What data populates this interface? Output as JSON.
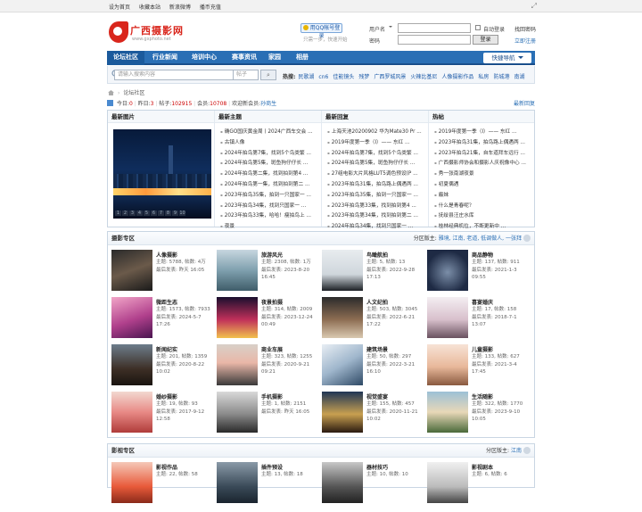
{
  "topbar": {
    "links": [
      "设为首页",
      "收藏本站",
      "新浪微博",
      "播币充值"
    ],
    "fullscreen_icon": "expand-icon"
  },
  "logo": {
    "title": "广西摄影网",
    "sub": "www.gxphoto.net"
  },
  "qq": {
    "label": "用QQ帐号登录",
    "sub": "只需一步，快速开始"
  },
  "login": {
    "user_type": "用户名",
    "password_label": "密码",
    "auto_login": "自动登录",
    "login_button": "登录",
    "find_password": "找回密码",
    "register": "立即注册"
  },
  "nav": {
    "items": [
      "论坛社区",
      "行业新闻",
      "培训中心",
      "赛事资讯",
      "家园",
      "相册"
    ],
    "quick": "快捷导航"
  },
  "search": {
    "placeholder": "请输入搜索内容",
    "scope": "帖子",
    "hot_label": "热搜:",
    "hot": [
      "民歌湖",
      "cn6",
      "佳能镜头",
      "残梦",
      "广西罗城风景",
      "火辣比基尼",
      "人像摄影作品",
      "私房",
      "防城港",
      "南湖"
    ]
  },
  "breadcrumb": "论坛社区",
  "stats": {
    "today_label": "今日:",
    "today": "0",
    "yesterday_label": "昨日:",
    "yesterday": "3",
    "posts_label": "帖子:",
    "posts": "102915",
    "members_label": "会员:",
    "members": "10708",
    "welcome_label": "欢迎新会员:",
    "newest": "孙商生",
    "new_reply": "最新回复"
  },
  "blocks": {
    "latest_image": "最新图片",
    "image_pager": [
      "1",
      "2",
      "3",
      "4",
      "5",
      "6",
      "7",
      "8",
      "9",
      "10"
    ],
    "latest_topics_title": "最新主题",
    "latest_topics": [
      "确GO国庆黄金周丨2024广西车交会 ...",
      "古镇人像",
      "2024年拍鸟第7集，找到5个鸟类繁 ...",
      "2024年拍鸟第5集，斑鱼狗仔仔长 ...",
      "2024年拍鸟第二集，找到拍到第4 ...",
      "2024年拍鸟第一集，找到拍到第二 ...",
      "2023年拍鸟35集，拍到一只国家一 ...",
      "2023年拍鸟34集，找到只国家一 ...",
      "2023年拍鸟33集，哈哈！瘦拍鸟上 ...",
      "夜景"
    ],
    "latest_replies_title": "最新回复",
    "latest_replies": [
      "上海天池20200902 华为Mate30 Pr ...",
      "2019年度第一季（I）—— 东红 ...",
      "2024年拍鸟第7集，找到5个鸟类繁 ...",
      "2024年拍鸟第5集，斑鱼狗仔仔长 ...",
      "27组电影大片风格LUT5调色预设(P ...",
      "2023年拍鸟31集，拍鸟路上偶遇两 ...",
      "2023年拍鸟35集，拍到一只国家一 ...",
      "2023年拍鸟第33集，找到拍到第4 ...",
      "2023年拍鸟第34集，找到拍到第二 ...",
      "2024年拍鸟34集，找到只国家一 ..."
    ],
    "hot_title": "热帖",
    "hot_posts": [
      "2019年度第一季（I）—— 东红 ...",
      "2023年拍鸟31集，拍鸟路上偶遇两 ...",
      "2023年拍鸟21集，自车道拜车远行 ...",
      "广西摄影师协会和摄影人庆祝像中心 ...",
      "秀一张南湖夜景",
      "初夏偶遇",
      "霰妹",
      "什么是青春呢？",
      "抚绥县汪庄水库",
      "桂林经典机位，不断更新中 ..."
    ]
  },
  "photo_section": {
    "title": "摄影专区",
    "mods_label": "分区版主:",
    "mods": "雅境, 江南, 老道, 低调做人, 一张拜",
    "forums": [
      {
        "name": "人像摄影",
        "topics": "5788",
        "posts": "4万",
        "last": "昨天 16:05"
      },
      {
        "name": "旅游风光",
        "topics": "2308",
        "posts": "1万",
        "last": "2023-8-20 16:45"
      },
      {
        "name": "鸟瞰航拍",
        "topics": "5",
        "posts": "13",
        "last": "2022-9-28 17:13"
      },
      {
        "name": "商品静物",
        "topics": "137",
        "posts": "911",
        "last": "2021-1-3 09:55"
      },
      {
        "name": "微距生态",
        "topics": "1573",
        "posts": "7933",
        "last": "2024-5-7 17:26"
      },
      {
        "name": "夜景拍摄",
        "topics": "314",
        "posts": "2009",
        "last": "2023-12-24 00:49"
      },
      {
        "name": "人文纪拍",
        "topics": "503",
        "posts": "3045",
        "last": "2022-6-21 17:22"
      },
      {
        "name": "喜宴婚庆",
        "topics": "17",
        "posts": "158",
        "last": "2018-7-1 13:07"
      },
      {
        "name": "新闻纪实",
        "topics": "201",
        "posts": "1359",
        "last": "2020-8-22 10:02"
      },
      {
        "name": "商业车展",
        "topics": "323",
        "posts": "1255",
        "last": "2020-9-21 09:21"
      },
      {
        "name": "建筑场景",
        "topics": "50",
        "posts": "297",
        "last": "2022-3-21 16:10"
      },
      {
        "name": "儿童摄影",
        "topics": "133",
        "posts": "627",
        "last": "2021-3-4 17:45"
      },
      {
        "name": "婚纱摄影",
        "topics": "19",
        "posts": "93",
        "last": "2017-9-12 12:58"
      },
      {
        "name": "手机摄影",
        "topics": "1",
        "posts": "2151",
        "last": "昨天 16:05"
      },
      {
        "name": "视觉盛宴",
        "topics": "155",
        "posts": "457",
        "last": "2020-11-21 10:02"
      },
      {
        "name": "生活随影",
        "topics": "322",
        "posts": "1770",
        "last": "2023-9-10 10:05"
      }
    ],
    "labels": {
      "topics": "主题:",
      "posts": "帖数:",
      "last": "最后发表:"
    }
  },
  "video_section": {
    "title": "影视专区",
    "mods_label": "分区版主:",
    "mods": "江南",
    "forums": [
      {
        "name": "影视作品",
        "topics": "22",
        "posts": "58"
      },
      {
        "name": "插件预设",
        "topics": "13",
        "posts": "18"
      },
      {
        "name": "器材技巧",
        "topics": "10",
        "posts": "10"
      },
      {
        "name": "影视剧本",
        "topics": "6",
        "posts": "6"
      }
    ]
  }
}
